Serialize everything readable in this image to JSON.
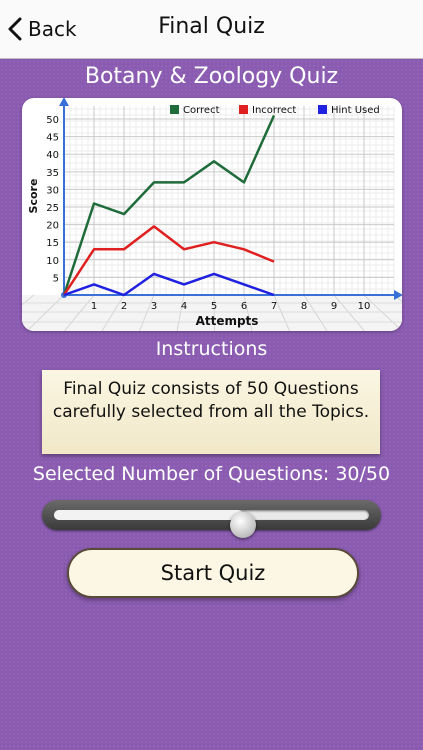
{
  "navbar": {
    "back_label": "Back",
    "title": "Final Quiz"
  },
  "quiz": {
    "title": "Botany & Zoology Quiz"
  },
  "instructions": {
    "title": "Instructions",
    "text": "Final Quiz consists of 50 Questions carefully selected from all the Topics."
  },
  "selection": {
    "label": "Selected Number of Questions: 30/50",
    "value": 30,
    "max": 50
  },
  "start_button": {
    "label": "Start Quiz"
  },
  "colors": {
    "correct": "#1f6b3a",
    "incorrect": "#e02020",
    "hint": "#2020e0",
    "background": "#8a5bb0"
  },
  "chart_data": {
    "type": "line",
    "xlabel": "Attempts",
    "ylabel": "Score",
    "x": [
      0,
      1,
      2,
      3,
      4,
      5,
      6,
      7
    ],
    "xticks": [
      1,
      2,
      3,
      4,
      5,
      6,
      7,
      8,
      9,
      10
    ],
    "yticks": [
      5,
      10,
      15,
      20,
      25,
      30,
      35,
      40,
      45,
      50
    ],
    "xlim": [
      0,
      11
    ],
    "ylim": [
      0,
      52
    ],
    "grid": true,
    "legend": "top-right",
    "series": [
      {
        "name": "Correct",
        "color": "#1f6b3a",
        "values": [
          0,
          26,
          23,
          32,
          32,
          38,
          32,
          51
        ]
      },
      {
        "name": "Incorrect",
        "color": "#e02020",
        "values": [
          0,
          13,
          13,
          19.5,
          13,
          15,
          13,
          9.5
        ]
      },
      {
        "name": "Hint Used",
        "color": "#2020e0",
        "values": [
          0,
          3,
          0,
          6,
          3,
          6,
          3,
          0
        ]
      }
    ]
  }
}
